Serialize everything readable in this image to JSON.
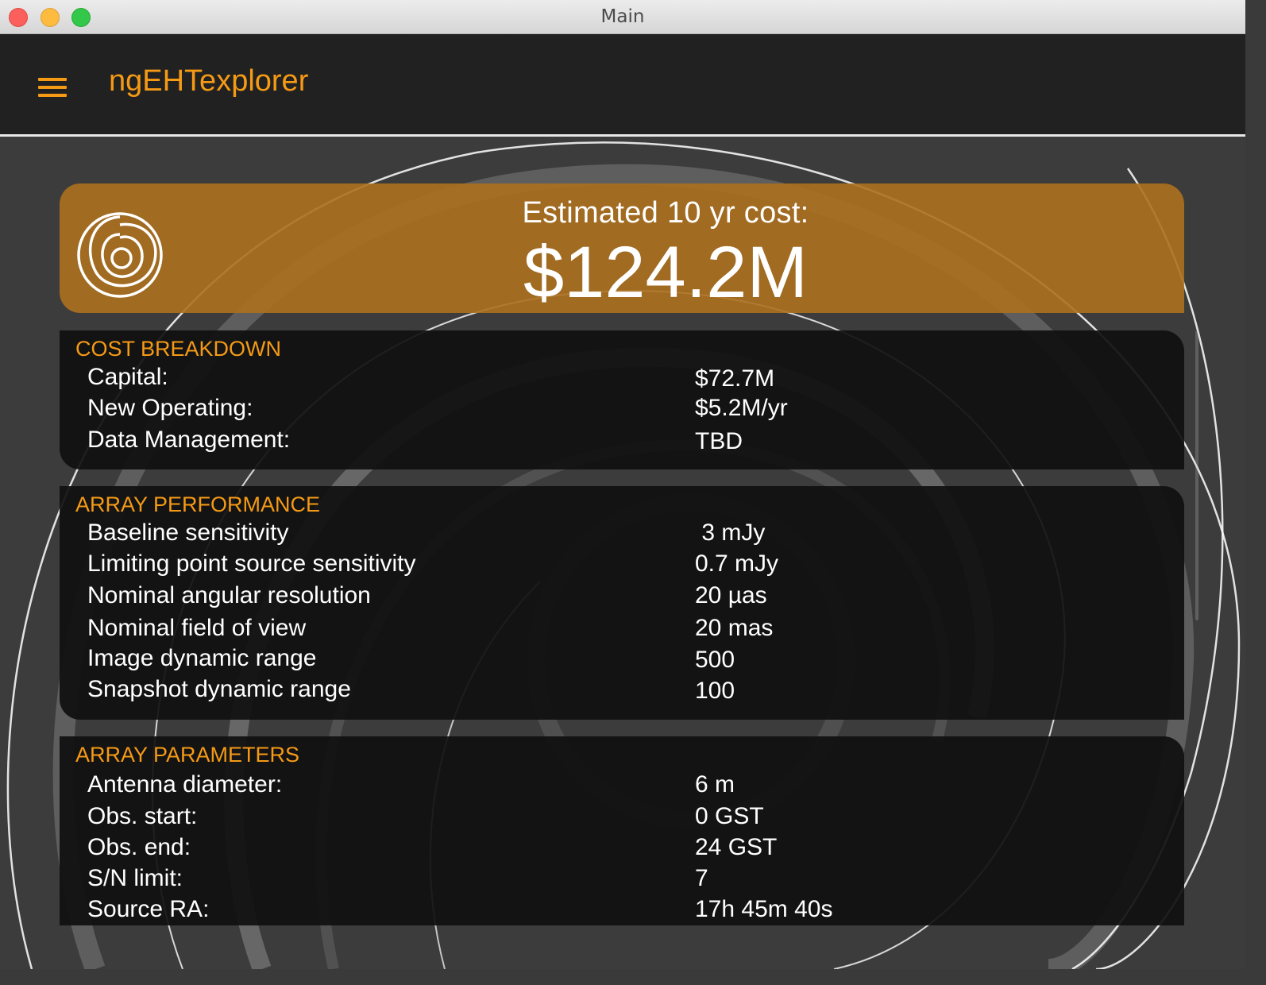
{
  "window": {
    "title": "Main"
  },
  "header": {
    "app_title": "ngEHTexplorer",
    "menu_icon": "hamburger-menu-icon"
  },
  "colors": {
    "accent": "#f59a15",
    "banner": "#a86d1e",
    "panel_bg": "#101010",
    "appbar_bg": "#212121",
    "page_bg": "#3c3c3c"
  },
  "banner": {
    "logo_icon": "ngeht-rings-logo-icon",
    "label": "Estimated 10 yr cost:",
    "value": "$124.2M"
  },
  "sections": {
    "cost_breakdown": {
      "title": "COST BREAKDOWN",
      "rows": [
        {
          "label": "Capital:",
          "value": "$72.7M"
        },
        {
          "label": "New Operating:",
          "value": "$5.2M/yr"
        },
        {
          "label": "Data Management:",
          "value": "TBD"
        }
      ]
    },
    "array_performance": {
      "title": "ARRAY PERFORMANCE",
      "rows": [
        {
          "label": "Baseline sensitivity",
          "value": " 3 mJy"
        },
        {
          "label": "Limiting point source sensitivity",
          "value": "0.7 mJy"
        },
        {
          "label": "Nominal angular resolution",
          "value": "20 µas"
        },
        {
          "label": "Nominal field of view",
          "value": "20 mas"
        },
        {
          "label": "Image dynamic range",
          "value": "500"
        },
        {
          "label": "Snapshot dynamic range",
          "value": "100"
        }
      ]
    },
    "array_parameters": {
      "title": "ARRAY PARAMETERS",
      "rows": [
        {
          "label": "Antenna diameter:",
          "value": "6 m"
        },
        {
          "label": "Obs. start:",
          "value": "0 GST"
        },
        {
          "label": "Obs. end:",
          "value": "24 GST"
        },
        {
          "label": "S/N limit:",
          "value": "7"
        },
        {
          "label": "Source RA:",
          "value": "17h 45m 40s"
        }
      ]
    }
  }
}
